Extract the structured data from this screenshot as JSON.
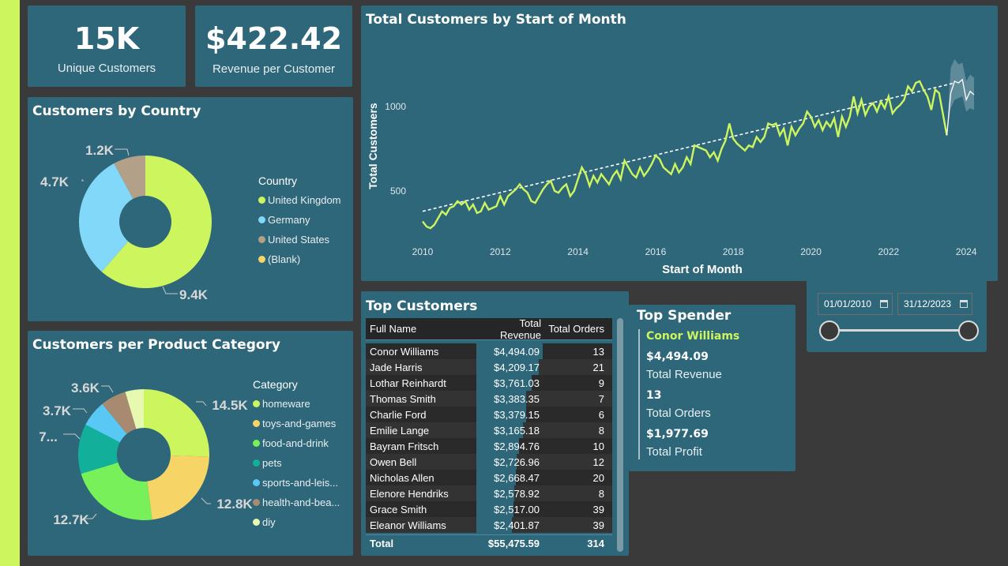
{
  "kpis": {
    "unique_customers": {
      "value": "15K",
      "label": "Unique Customers"
    },
    "revenue_per_customer": {
      "value": "$422.42",
      "label": "Revenue per Customer"
    }
  },
  "country": {
    "title": "Customers by Country",
    "legend_title": "Country",
    "items": [
      {
        "label": "United Kingdom",
        "value": 9400,
        "display": "9.4K",
        "color": "#cdf55d"
      },
      {
        "label": "Germany",
        "value": 4700,
        "display": "4.7K",
        "color": "#82d8f8"
      },
      {
        "label": "United States",
        "value": 1200,
        "display": "1.2K",
        "color": "#b3a088"
      },
      {
        "label": "(Blank)",
        "value": 0,
        "display": "",
        "color": "#f7d466"
      }
    ]
  },
  "category": {
    "title": "Customers per Product Category",
    "legend_title": "Category",
    "items": [
      {
        "label": "homeware",
        "value": 14500,
        "display": "14.5K",
        "color": "#cdf55d"
      },
      {
        "label": "toys-and-games",
        "value": 12800,
        "display": "12.8K",
        "color": "#f7d466"
      },
      {
        "label": "food-and-drink",
        "value": 12700,
        "display": "12.7K",
        "color": "#77f05a"
      },
      {
        "label": "pets",
        "value": 7000,
        "display": "7...",
        "color": "#12b09a"
      },
      {
        "label": "sports-and-leis...",
        "value": 3700,
        "display": "3.7K",
        "color": "#5ac8f4"
      },
      {
        "label": "health-and-bea...",
        "value": 3600,
        "display": "3.6K",
        "color": "#a88a70"
      },
      {
        "label": "diy",
        "value": 2600,
        "display": "",
        "color": "#e7f8b0"
      }
    ]
  },
  "line_chart": {
    "title": "Total Customers by Start of Month",
    "xlabel": "Start of Month",
    "ylabel": "Total Customers",
    "x_ticks": [
      "2010",
      "2012",
      "2014",
      "2016",
      "2018",
      "2020",
      "2022",
      "2024"
    ],
    "y_ticks": [
      "500",
      "1000"
    ]
  },
  "chart_data": {
    "type": "line",
    "title": "Total Customers by Start of Month",
    "xlabel": "Start of Month",
    "ylabel": "Total Customers",
    "xlim": [
      2010.0,
      2024.2
    ],
    "ylim": [
      320,
      1250
    ],
    "line_color": "#cdf55d",
    "series": [
      {
        "values": [
          [
            2010.0,
            320
          ],
          [
            2010.1,
            290
          ],
          [
            2010.2,
            280
          ],
          [
            2010.3,
            300
          ],
          [
            2010.4,
            340
          ],
          [
            2010.5,
            380
          ],
          [
            2010.6,
            360
          ],
          [
            2010.7,
            400
          ],
          [
            2010.8,
            410
          ],
          [
            2010.9,
            440
          ],
          [
            2011.0,
            420
          ],
          [
            2011.1,
            440
          ],
          [
            2011.2,
            390
          ],
          [
            2011.3,
            420
          ],
          [
            2011.4,
            370
          ],
          [
            2011.5,
            380
          ],
          [
            2011.6,
            430
          ],
          [
            2011.7,
            390
          ],
          [
            2011.8,
            400
          ],
          [
            2011.9,
            410
          ],
          [
            2012.0,
            470
          ],
          [
            2012.1,
            420
          ],
          [
            2012.2,
            470
          ],
          [
            2012.3,
            490
          ],
          [
            2012.4,
            510
          ],
          [
            2012.5,
            540
          ],
          [
            2012.6,
            510
          ],
          [
            2012.7,
            490
          ],
          [
            2012.8,
            440
          ],
          [
            2012.9,
            430
          ],
          [
            2013.0,
            470
          ],
          [
            2013.1,
            510
          ],
          [
            2013.2,
            540
          ],
          [
            2013.3,
            560
          ],
          [
            2013.4,
            500
          ],
          [
            2013.5,
            490
          ],
          [
            2013.6,
            520
          ],
          [
            2013.7,
            540
          ],
          [
            2013.8,
            470
          ],
          [
            2013.9,
            500
          ],
          [
            2014.0,
            570
          ],
          [
            2014.1,
            640
          ],
          [
            2014.2,
            600
          ],
          [
            2014.3,
            530
          ],
          [
            2014.4,
            590
          ],
          [
            2014.5,
            550
          ],
          [
            2014.6,
            600
          ],
          [
            2014.7,
            570
          ],
          [
            2014.8,
            540
          ],
          [
            2014.9,
            590
          ],
          [
            2015.0,
            620
          ],
          [
            2015.1,
            570
          ],
          [
            2015.2,
            680
          ],
          [
            2015.3,
            640
          ],
          [
            2015.4,
            600
          ],
          [
            2015.5,
            580
          ],
          [
            2015.6,
            640
          ],
          [
            2015.7,
            590
          ],
          [
            2015.8,
            620
          ],
          [
            2015.9,
            660
          ],
          [
            2016.0,
            710
          ],
          [
            2016.1,
            690
          ],
          [
            2016.2,
            640
          ],
          [
            2016.3,
            620
          ],
          [
            2016.4,
            600
          ],
          [
            2016.5,
            660
          ],
          [
            2016.6,
            610
          ],
          [
            2016.7,
            640
          ],
          [
            2016.8,
            700
          ],
          [
            2016.9,
            660
          ],
          [
            2017.0,
            770
          ],
          [
            2017.1,
            760
          ],
          [
            2017.2,
            750
          ],
          [
            2017.3,
            740
          ],
          [
            2017.4,
            700
          ],
          [
            2017.5,
            730
          ],
          [
            2017.6,
            680
          ],
          [
            2017.7,
            750
          ],
          [
            2017.8,
            800
          ],
          [
            2017.9,
            900
          ],
          [
            2018.0,
            810
          ],
          [
            2018.1,
            780
          ],
          [
            2018.2,
            760
          ],
          [
            2018.3,
            740
          ],
          [
            2018.4,
            770
          ],
          [
            2018.5,
            760
          ],
          [
            2018.6,
            820
          ],
          [
            2018.7,
            790
          ],
          [
            2018.8,
            820
          ],
          [
            2018.9,
            900
          ],
          [
            2019.0,
            890
          ],
          [
            2019.1,
            900
          ],
          [
            2019.2,
            830
          ],
          [
            2019.3,
            870
          ],
          [
            2019.4,
            770
          ],
          [
            2019.5,
            880
          ],
          [
            2019.6,
            830
          ],
          [
            2019.7,
            870
          ],
          [
            2019.8,
            900
          ],
          [
            2019.9,
            970
          ],
          [
            2020.0,
            940
          ],
          [
            2020.1,
            880
          ],
          [
            2020.2,
            920
          ],
          [
            2020.3,
            860
          ],
          [
            2020.4,
            910
          ],
          [
            2020.5,
            880
          ],
          [
            2020.6,
            930
          ],
          [
            2020.7,
            820
          ],
          [
            2020.8,
            940
          ],
          [
            2020.9,
            880
          ],
          [
            2021.0,
            940
          ],
          [
            2021.1,
            1060
          ],
          [
            2021.2,
            960
          ],
          [
            2021.3,
            1040
          ],
          [
            2021.4,
            950
          ],
          [
            2021.5,
            1000
          ],
          [
            2021.6,
            1020
          ],
          [
            2021.7,
            970
          ],
          [
            2021.8,
            1030
          ],
          [
            2021.9,
            990
          ],
          [
            2022.0,
            1060
          ],
          [
            2022.1,
            960
          ],
          [
            2022.2,
            990
          ],
          [
            2022.3,
            1010
          ],
          [
            2022.4,
            1040
          ],
          [
            2022.5,
            1120
          ],
          [
            2022.6,
            1090
          ],
          [
            2022.7,
            1140
          ],
          [
            2022.8,
            1150
          ],
          [
            2022.9,
            1100
          ],
          [
            2023.0,
            1060
          ],
          [
            2023.1,
            980
          ],
          [
            2023.2,
            1100
          ],
          [
            2023.3,
            1080
          ],
          [
            2023.5,
            830
          ]
        ]
      },
      {
        "name": "forecast",
        "values": [
          [
            2023.5,
            830
          ],
          [
            2023.6,
            1080
          ],
          [
            2023.7,
            1150
          ],
          [
            2023.8,
            1140
          ],
          [
            2023.9,
            1160
          ],
          [
            2024.0,
            1040
          ],
          [
            2024.1,
            1090
          ],
          [
            2024.2,
            1070
          ]
        ]
      }
    ],
    "trend": [
      [
        2010.0,
        380
      ],
      [
        2023.7,
        1140
      ]
    ],
    "forecast_band": {
      "lower": [
        [
          2023.5,
          830
        ],
        [
          2023.6,
          990
        ],
        [
          2023.7,
          1040
        ],
        [
          2023.8,
          1050
        ],
        [
          2023.9,
          1060
        ],
        [
          2024.0,
          970
        ],
        [
          2024.1,
          990
        ],
        [
          2024.2,
          980
        ]
      ],
      "upper": [
        [
          2023.5,
          830
        ],
        [
          2023.6,
          1230
        ],
        [
          2023.7,
          1280
        ],
        [
          2023.8,
          1250
        ],
        [
          2023.9,
          1260
        ],
        [
          2024.0,
          1150
        ],
        [
          2024.1,
          1190
        ],
        [
          2024.2,
          1170
        ]
      ]
    }
  },
  "top_customers": {
    "title": "Top Customers",
    "columns": [
      "Full Name",
      "Total Revenue",
      "Total Orders"
    ],
    "rows": [
      {
        "name": "Conor Williams",
        "revenue": "$4,494.09",
        "revenue_value": 4494.09,
        "orders": "13"
      },
      {
        "name": "Jade Harris",
        "revenue": "$4,209.17",
        "revenue_value": 4209.17,
        "orders": "21"
      },
      {
        "name": "Lothar Reinhardt",
        "revenue": "$3,761.03",
        "revenue_value": 3761.03,
        "orders": "9"
      },
      {
        "name": "Thomas Smith",
        "revenue": "$3,383.35",
        "revenue_value": 3383.35,
        "orders": "7"
      },
      {
        "name": "Charlie Ford",
        "revenue": "$3,379.15",
        "revenue_value": 3379.15,
        "orders": "6"
      },
      {
        "name": "Emilie Lange",
        "revenue": "$3,165.18",
        "revenue_value": 3165.18,
        "orders": "8"
      },
      {
        "name": "Bayram Fritsch",
        "revenue": "$2,894.76",
        "revenue_value": 2894.76,
        "orders": "10"
      },
      {
        "name": "Owen Bell",
        "revenue": "$2,726.96",
        "revenue_value": 2726.96,
        "orders": "12"
      },
      {
        "name": "Nicholas Allen",
        "revenue": "$2,668.47",
        "revenue_value": 2668.47,
        "orders": "20"
      },
      {
        "name": "Elenore Hendriks",
        "revenue": "$2,578.92",
        "revenue_value": 2578.92,
        "orders": "8"
      },
      {
        "name": "Grace Smith",
        "revenue": "$2,517.00",
        "revenue_value": 2517.0,
        "orders": "39"
      },
      {
        "name": "Eleanor Williams",
        "revenue": "$2,401.87",
        "revenue_value": 2401.87,
        "orders": "39"
      }
    ],
    "total": {
      "label": "Total",
      "revenue": "$55,475.59",
      "orders": "314"
    }
  },
  "top_spender": {
    "title": "Top Spender",
    "name": "Conor Williams",
    "revenue": "$4,494.09",
    "revenue_label": "Total Revenue",
    "orders": "13",
    "orders_label": "Total Orders",
    "profit": "$1,977.69",
    "profit_label": "Total Profit"
  },
  "date_slicer": {
    "start": "01/01/2010",
    "end": "31/12/2023",
    "range_fraction": [
      0.0,
      1.0
    ]
  },
  "colors": {
    "accent": "#cdf55d",
    "card": "#2e6779",
    "background": "#3a3a3a"
  }
}
